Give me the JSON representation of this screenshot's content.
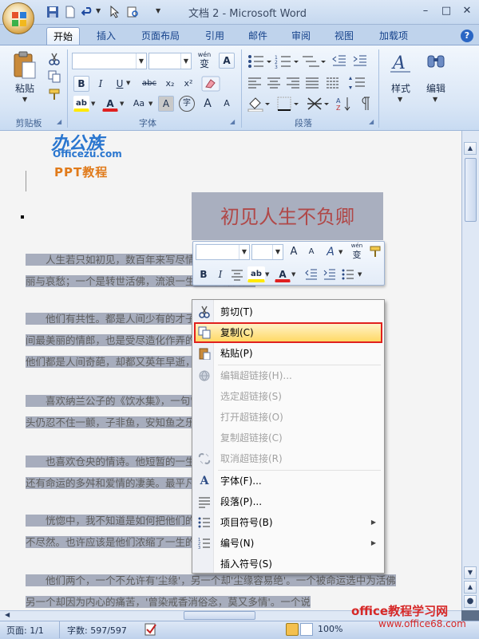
{
  "window": {
    "title": "文档 2 - Microsoft Word",
    "minimize": "–",
    "maximize": "□",
    "close": "✕"
  },
  "tabs": [
    "开始",
    "插入",
    "页面布局",
    "引用",
    "邮件",
    "审阅",
    "视图",
    "加载项"
  ],
  "ribbon": {
    "paste_label": "粘贴",
    "clipboard_group": "剪贴板",
    "font_group": "字体",
    "paragraph_group": "段落",
    "styles_label": "样式",
    "edit_label": "编辑",
    "wen_label": "wén",
    "wen_char": "变",
    "bold": "B",
    "italic": "I",
    "underline": "U",
    "strike": "abc",
    "subscript": "x₂",
    "superscript": "x²",
    "grow_font": "A",
    "shrink_font": "A",
    "font_case": "Aa",
    "char_shading": "A",
    "enclose": "字",
    "help": "?"
  },
  "watermark": {
    "brand": "办公族",
    "domain": "Officezu.com",
    "sub": "PPT教程",
    "site_name": "office教程学习网",
    "site_url": "www.office68.com"
  },
  "document": {
    "title": "初见人生不负卿",
    "paragraphs": [
      "　　人生若只如初见，数百年来写尽情深意切纳兰容若。两个同人，写尽人生",
      "丽与哀愁；一个是转世活佛，流浪一生的仓央嘉措。",
      "　　他们有共性。都是人间少有的才子，都是一生不曾真正快乐。他们都期",
      "间最美丽的情郎，也是受尽造化作弄的可怜人。他们都是少数民",
      "他们都是人间奇葩，却都又英年早逝，仿佛夏花般绚烂。",
      "　　喜欢纳兰公子的《饮水集》，一句'饮水，冷暖自知'，这八个字，让人",
      "头仍忍不住一颤，子非鱼，安知鱼之乐？万千情绪最终归于冷暖自知。",
      "　　也喜欢仓央的情诗。他短暂的一生，有宗教的信仰，又有政治的诡",
      "还有命运的多舛和爱情的凄美。最平凡的爱恨",
      "　　恍惚中，我不知道是如何把他们的文采？好像",
      "不尽然。也许应该是他们浓缩了一生的",
      "　　他们两个，一个不允许有'尘缘'，另一个却'尘缘容易绝'。一个被命运选中为活佛",
      "另一个却因为内心的痛苦，'曾染戒香消俗念，莫又多情'。一个说"
    ]
  },
  "context_menu": {
    "items": [
      {
        "label": "剪切(T)",
        "icon": "scissors-icon",
        "enabled": true
      },
      {
        "label": "复制(C)",
        "icon": "copy-icon",
        "enabled": true,
        "highlighted": true
      },
      {
        "label": "粘贴(P)",
        "icon": "paste-icon",
        "enabled": true
      },
      {
        "label": "编辑超链接(H)...",
        "icon": "globe-icon",
        "enabled": false
      },
      {
        "label": "选定超链接(S)",
        "icon": "",
        "enabled": false
      },
      {
        "label": "打开超链接(O)",
        "icon": "",
        "enabled": false
      },
      {
        "label": "复制超链接(C)",
        "icon": "",
        "enabled": false
      },
      {
        "label": "取消超链接(R)",
        "icon": "unlink-icon",
        "enabled": false
      },
      {
        "label": "字体(F)...",
        "icon": "font-icon",
        "enabled": true
      },
      {
        "label": "段落(P)...",
        "icon": "paragraph-icon",
        "enabled": true
      },
      {
        "label": "项目符号(B)",
        "icon": "bullets-icon",
        "enabled": true,
        "submenu": true
      },
      {
        "label": "编号(N)",
        "icon": "numbering-icon",
        "enabled": true,
        "submenu": true
      },
      {
        "label": "插入符号(S)",
        "icon": "",
        "enabled": true
      }
    ]
  },
  "status": {
    "page": "页面: 1/1",
    "words": "字数: 597/597",
    "zoom": "100%"
  }
}
